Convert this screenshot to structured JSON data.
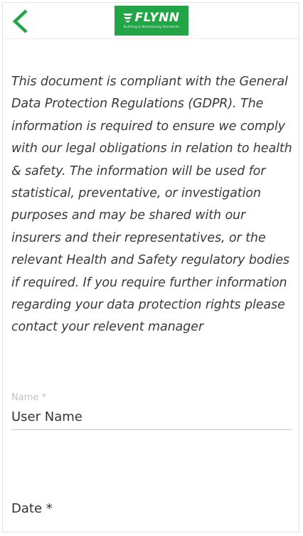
{
  "header": {
    "back_icon": "chevron-left-icon",
    "logo": {
      "wordmark": "FLYNN",
      "tagline": "Building & Maintaining Standards",
      "background": "#22a547"
    }
  },
  "gdpr_notice": "This document is compliant with the General Data Protection Regulations (GDPR). The information is required to ensure we comply with our legal obligations in relation to health & safety. The information will be used for statistical, preventative, or investigation purposes and may be shared with our insurers and their representatives, or the relevant Health and Safety regulatory bodies if required. If you require further information regarding your data protection rights please contact your relevent manager",
  "form": {
    "name": {
      "label": "Name *",
      "value": "User Name"
    },
    "date": {
      "label": "Date *"
    }
  },
  "colors": {
    "accent": "#22a547",
    "text": "#333333",
    "muted_label": "#c2c2c2"
  }
}
